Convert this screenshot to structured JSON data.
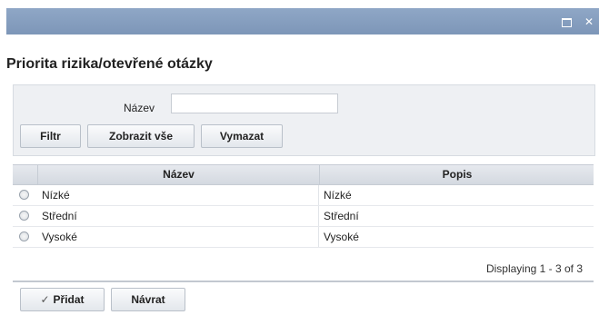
{
  "window": {
    "maximize_icon": "maximize-icon",
    "close_icon": "close-icon",
    "close_glyph": "✕"
  },
  "page": {
    "title": "Priorita rizika/otevřené otázky"
  },
  "filter": {
    "name_label": "Název",
    "name_value": "",
    "buttons": {
      "filter": "Filtr",
      "show_all": "Zobrazit vše",
      "clear": "Vymazat"
    }
  },
  "grid": {
    "columns": [
      "Název",
      "Popis"
    ],
    "rows": [
      {
        "name": "Nízké",
        "description": "Nízké"
      },
      {
        "name": "Střední",
        "description": "Střední"
      },
      {
        "name": "Vysoké",
        "description": "Vysoké"
      }
    ],
    "paging": "Displaying 1 - 3 of 3"
  },
  "actions": {
    "add": "Přidat",
    "add_icon": "checkmark-icon",
    "add_glyph": "✓",
    "back": "Návrat"
  },
  "colors": {
    "titlebar": "#7d96b8",
    "panel": "#eef0f3"
  }
}
